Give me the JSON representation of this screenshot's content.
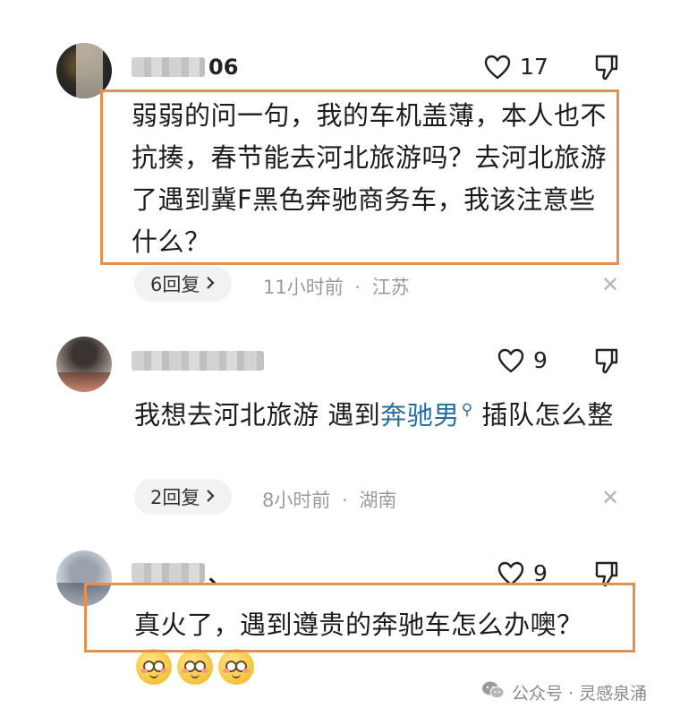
{
  "colors": {
    "highlight_box": "#e39150",
    "link_blue": "#2a6c9e",
    "pill_bg": "#f2f2f2",
    "meta_gray": "#9a9a9a"
  },
  "comments": [
    {
      "username_visible": "06",
      "likes": "17",
      "text": "弱弱的问一句，我的车机盖薄，本人也不抗揍，春节能去河北旅游吗？去河北旅游了遇到冀F黑色奔驰商务车，我该注意些什么？",
      "reply_label": "6回复",
      "time": "11小时前",
      "separator": "·",
      "location": "江苏",
      "highlighted": true
    },
    {
      "username_visible": "",
      "likes": "9",
      "text_before_link": "我想去河北旅游 遇到",
      "link_text": "奔驰男",
      "text_after_link": " 插队怎么整",
      "reply_label": "2回复",
      "time": "8小时前",
      "separator": "·",
      "location": "湖南",
      "highlighted": false
    },
    {
      "username_visible": "、",
      "likes": "9",
      "text": "真火了，遇到遵贵的奔驰车怎么办噢？",
      "emoji_count": 3,
      "highlighted": true
    }
  ],
  "icons": {
    "like": "heart-outline-icon",
    "dislike": "thumbs-down-icon",
    "close": "close-x-icon",
    "chevron": "chevron-right-icon",
    "search": "search-icon",
    "wechat": "wechat-official-account-icon"
  },
  "watermark": {
    "text": "公众号 · 灵感泉涌"
  }
}
